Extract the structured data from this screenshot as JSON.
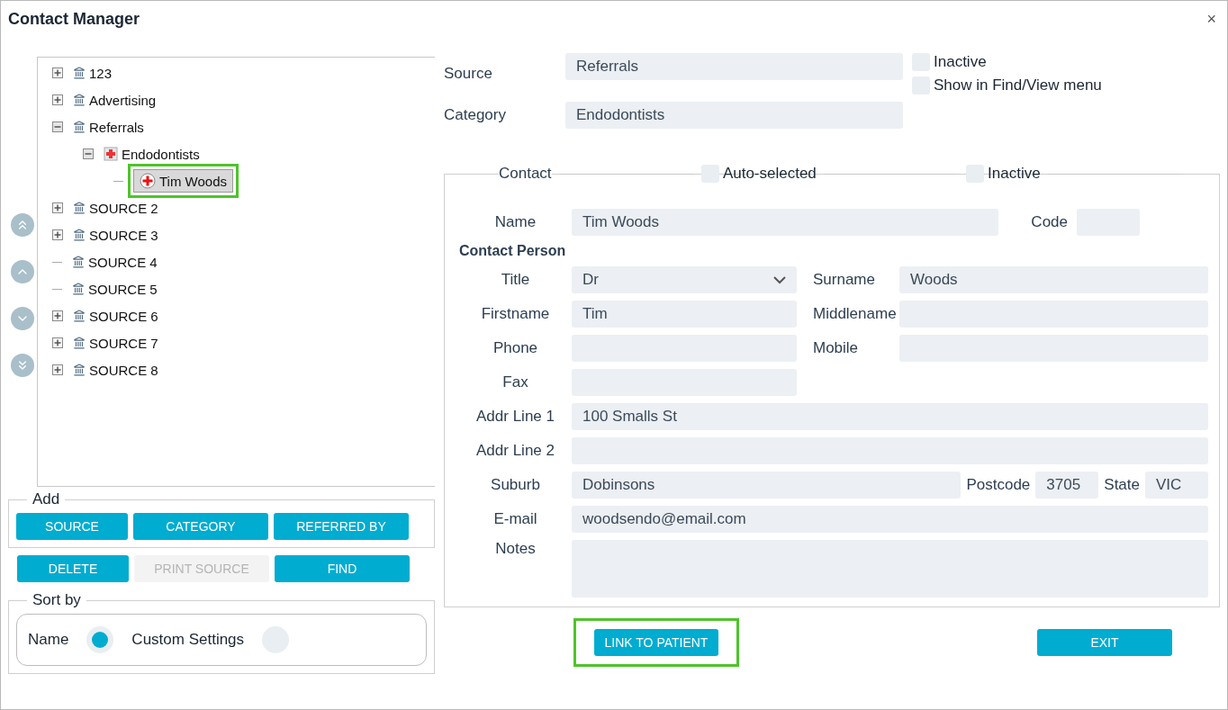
{
  "window": {
    "title": "Contact Manager",
    "close": "×"
  },
  "tree": [
    {
      "label": "123",
      "kind": "source",
      "expandable": true,
      "expanded": false,
      "selected": false,
      "highlighted": false
    },
    {
      "label": "Advertising",
      "kind": "source",
      "expandable": true,
      "expanded": false,
      "selected": false,
      "highlighted": false
    },
    {
      "label": "Referrals",
      "kind": "source",
      "expandable": true,
      "expanded": true,
      "selected": false,
      "highlighted": false,
      "children": [
        {
          "label": "Endodontists",
          "kind": "category",
          "expandable": true,
          "expanded": true,
          "selected": false,
          "highlighted": false,
          "children": [
            {
              "label": "Tim Woods",
              "kind": "contact",
              "expandable": false,
              "selected": true,
              "highlighted": true
            }
          ]
        }
      ]
    },
    {
      "label": "SOURCE 2",
      "kind": "source",
      "expandable": true,
      "expanded": false,
      "selected": false,
      "highlighted": false
    },
    {
      "label": "SOURCE 3",
      "kind": "source",
      "expandable": true,
      "expanded": false,
      "selected": false,
      "highlighted": false
    },
    {
      "label": "SOURCE 4",
      "kind": "source",
      "expandable": false,
      "selected": false,
      "highlighted": false
    },
    {
      "label": "SOURCE 5",
      "kind": "source",
      "expandable": false,
      "selected": false,
      "highlighted": false
    },
    {
      "label": "SOURCE 6",
      "kind": "source",
      "expandable": true,
      "expanded": false,
      "selected": false,
      "highlighted": false
    },
    {
      "label": "SOURCE 7",
      "kind": "source",
      "expandable": true,
      "expanded": false,
      "selected": false,
      "highlighted": false
    },
    {
      "label": "SOURCE 8",
      "kind": "source",
      "expandable": true,
      "expanded": false,
      "selected": false,
      "highlighted": false
    }
  ],
  "add_group": {
    "legend": "Add",
    "buttons": [
      {
        "label": "SOURCE",
        "disabled": false
      },
      {
        "label": "CATEGORY",
        "disabled": false
      },
      {
        "label": "REFERRED BY",
        "disabled": false
      }
    ]
  },
  "action_buttons": [
    {
      "label": "DELETE",
      "disabled": false
    },
    {
      "label": "PRINT SOURCE",
      "disabled": true
    },
    {
      "label": "FIND",
      "disabled": false
    }
  ],
  "sort_group": {
    "legend": "Sort by",
    "options": [
      {
        "label": "Name",
        "selected": true
      },
      {
        "label": "Custom Settings",
        "selected": false
      }
    ]
  },
  "source": {
    "label": "Source",
    "value": "Referrals"
  },
  "source_flags": [
    {
      "label": "Inactive",
      "checked": false
    },
    {
      "label": "Show in Find/View menu",
      "checked": false
    }
  ],
  "category": {
    "label": "Category",
    "value": "Endodontists"
  },
  "contact": {
    "legend": "Contact",
    "flags": [
      {
        "label": "Auto-selected",
        "checked": false
      },
      {
        "label": "Inactive",
        "checked": false
      }
    ],
    "name": {
      "label": "Name",
      "value": "Tim Woods"
    },
    "code": {
      "label": "Code"
    },
    "section": "Contact Person",
    "title": {
      "label": "Title",
      "value": "Dr"
    },
    "surname": {
      "label": "Surname",
      "value": "Woods"
    },
    "firstname": {
      "label": "Firstname",
      "value": "Tim"
    },
    "middlename": {
      "label": "Middlename"
    },
    "phone": {
      "label": "Phone"
    },
    "mobile": {
      "label": "Mobile"
    },
    "fax": {
      "label": "Fax"
    },
    "addr1": {
      "label": "Addr Line 1",
      "value": "100 Smalls St"
    },
    "addr2": {
      "label": "Addr Line 2"
    },
    "suburb": {
      "label": "Suburb",
      "value": "Dobinsons"
    },
    "postcode": {
      "label": "Postcode",
      "value": "3705"
    },
    "state": {
      "label": "State",
      "value": "VIC"
    },
    "email": {
      "label": "E-mail",
      "value": "woodsendo@email.com"
    },
    "notes": {
      "label": "Notes"
    }
  },
  "footer_buttons": [
    {
      "label": "LINK TO PATIENT",
      "highlighted": true
    },
    {
      "label": "EXIT",
      "highlighted": false
    }
  ]
}
